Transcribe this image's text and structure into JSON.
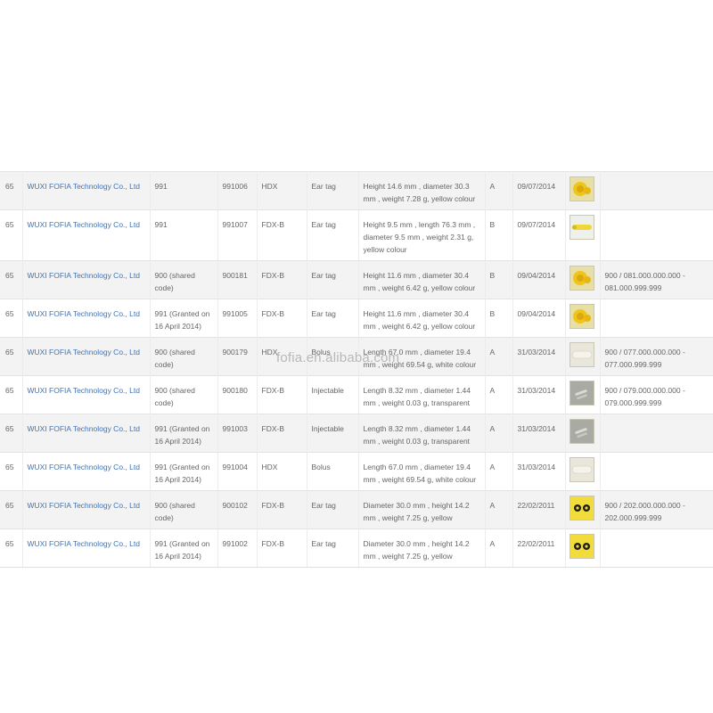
{
  "rows": [
    {
      "num": "65",
      "company": "WUXI FOFIA Technology Co., Ltd",
      "code": "991",
      "id": "991006",
      "tech": "HDX",
      "type": "Ear tag",
      "desc": "Height 14.6 mm , diameter 30.3 mm , weight 7.28 g, yellow colour",
      "cls": "A",
      "date": "09/07/2014",
      "image": "yellow-round-ear-tag",
      "range": ""
    },
    {
      "num": "65",
      "company": "WUXI FOFIA Technology Co., Ltd",
      "code": "991",
      "id": "991007",
      "tech": "FDX-B",
      "type": "Ear tag",
      "desc": "Height 9.5 mm , length 76.3 mm , diameter 9.5 mm , weight 2.31 g, yellow colour",
      "cls": "B",
      "date": "09/07/2014",
      "image": "yellow-long-ear-tag",
      "range": ""
    },
    {
      "num": "65",
      "company": "WUXI FOFIA Technology Co., Ltd",
      "code": "900 (shared code)",
      "id": "900181",
      "tech": "FDX-B",
      "type": "Ear tag",
      "desc": "Height 11.6 mm , diameter 30.4 mm , weight 6.42 g, yellow colour",
      "cls": "B",
      "date": "09/04/2014",
      "image": "yellow-round-ear-tag",
      "range": "900 / 081.000.000.000 - 081.000.999.999"
    },
    {
      "num": "65",
      "company": "WUXI FOFIA Technology Co., Ltd",
      "code": "991 (Granted on 16 April 2014)",
      "id": "991005",
      "tech": "FDX-B",
      "type": "Ear tag",
      "desc": "Height 11.6 mm , diameter 30.4 mm , weight 6.42 g, yellow colour",
      "cls": "B",
      "date": "09/04/2014",
      "image": "yellow-round-ear-tag",
      "range": ""
    },
    {
      "num": "65",
      "company": "WUXI FOFIA Technology Co., Ltd",
      "code": "900 (shared code)",
      "id": "900179",
      "tech": "HDX",
      "type": "Bolus",
      "desc": "Length 67.0 mm , diameter 19.4 mm , weight 69.54 g, white colour",
      "cls": "A",
      "date": "31/03/2014",
      "image": "white-bolus",
      "range": "900 / 077.000.000.000 - 077.000.999.999"
    },
    {
      "num": "65",
      "company": "WUXI FOFIA Technology Co., Ltd",
      "code": "900 (shared code)",
      "id": "900180",
      "tech": "FDX-B",
      "type": "Injectable",
      "desc": "Length 8.32 mm , diameter 1.44 mm , weight 0.03 g, transparent",
      "cls": "A",
      "date": "31/03/2014",
      "image": "glass-injectable",
      "range": "900 / 079.000.000.000 - 079.000.999.999"
    },
    {
      "num": "65",
      "company": "WUXI FOFIA Technology Co., Ltd",
      "code": "991 (Granted on 16 April 2014)",
      "id": "991003",
      "tech": "FDX-B",
      "type": "Injectable",
      "desc": "Length 8.32 mm , diameter 1.44 mm , weight 0.03 g, transparent",
      "cls": "A",
      "date": "31/03/2014",
      "image": "glass-injectable",
      "range": ""
    },
    {
      "num": "65",
      "company": "WUXI FOFIA Technology Co., Ltd",
      "code": "991 (Granted on 16 April 2014)",
      "id": "991004",
      "tech": "HDX",
      "type": "Bolus",
      "desc": "Length 67.0 mm , diameter 19.4 mm , weight 69.54 g, white colour",
      "cls": "A",
      "date": "31/03/2014",
      "image": "white-bolus",
      "range": ""
    },
    {
      "num": "65",
      "company": "WUXI FOFIA Technology Co., Ltd",
      "code": "900 (shared code)",
      "id": "900102",
      "tech": "FDX-B",
      "type": "Ear tag",
      "desc": "Diameter 30.0 mm , height 14.2 mm , weight 7.25 g, yellow",
      "cls": "A",
      "date": "22/02/2011",
      "image": "yellow-button-ear-tag",
      "range": "900 / 202.000.000.000 - 202.000.999.999"
    },
    {
      "num": "65",
      "company": "WUXI FOFIA Technology Co., Ltd",
      "code": "991 (Granted on 16 April 2014)",
      "id": "991002",
      "tech": "FDX-B",
      "type": "Ear tag",
      "desc": "Diameter 30.0 mm , height 14.2 mm , weight 7.25 g, yellow",
      "cls": "A",
      "date": "22/02/2011",
      "image": "yellow-button-ear-tag",
      "range": ""
    }
  ],
  "watermark": "fofia.en.alibaba.com",
  "colors": {
    "link": "#3f74b6",
    "text": "#666666",
    "row_alt": "#f3f3f3",
    "border": "#e3e3e3"
  }
}
